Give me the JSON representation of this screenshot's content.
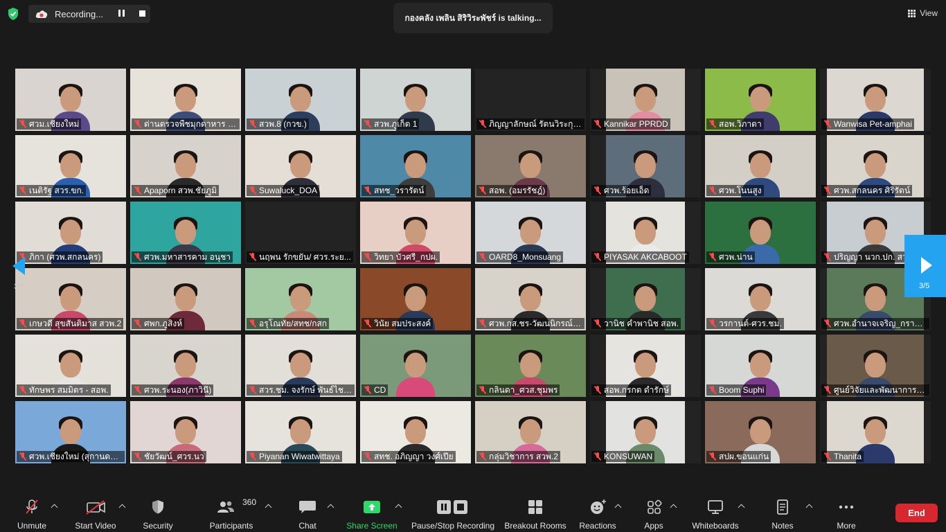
{
  "recording": {
    "label": "Recording..."
  },
  "talking": {
    "text": "กองคลัง เพลิน สิริวิระพัชร์ is  talking..."
  },
  "view": {
    "label": "View"
  },
  "pager": {
    "left": "3/5",
    "right": "3/5"
  },
  "colors": {
    "accent_blue": "#23a3f0",
    "end_red": "#d7282f",
    "share_green": "#2fd86a",
    "mic_off_red": "#ff4a4a"
  },
  "tiles": [
    {
      "name": "ศวม.เชียงใหม่",
      "bg": "#d9d4cf",
      "shirt": "#5b4a8a"
    },
    {
      "name": "ด่านตรวจพืชมุกดาหาร (ป...",
      "bg": "#e7e3da",
      "shirt": "#3d4d7a"
    },
    {
      "name": "สวพ.8 (กวข.)",
      "bg": "#c9d1d4",
      "shirt": "#2d3d5c"
    },
    {
      "name": "สวพ.ภูเก็ต 1",
      "bg": "#cfd5d2",
      "shirt": "#2f3a4a"
    },
    {
      "name": "ภิญญาลักษณ์ รัตนวิระกุล...",
      "bg": "#242424",
      "shirt": ""
    },
    {
      "name": "Kannikar PPRDD",
      "bg": "#c8c2b8",
      "shirt": "#e48da2"
    },
    {
      "name": "สอพ.วิภาดา",
      "bg": "#8dbb4a",
      "shirt": "#3f3c6e"
    },
    {
      "name": "Wanwisa Pet-amphai",
      "bg": "#dcd7d0",
      "shirt": "#2a3a66"
    },
    {
      "name": "เนติรัฐ สวร.ขก.",
      "bg": "#e6e2dc",
      "shirt": "#2b5fb0"
    },
    {
      "name": "Apaporn สวพ.ชัยภูมิ",
      "bg": "#d8d2cc",
      "shirt": "#2a2a2a"
    },
    {
      "name": "Suwaluck_DOA",
      "bg": "#e4ded6",
      "shirt": "#2f2f3b"
    },
    {
      "name": "สทช_วรารัตน์",
      "bg": "#4e8aa8",
      "shirt": "#3d3d3d"
    },
    {
      "name": "สอพ. (อมรรัชฎ์)",
      "bg": "#8a7a6e",
      "shirt": "#6a3a4a"
    },
    {
      "name": "ศวพ.ร้อยเอ็ด",
      "bg": "#5d6e7a",
      "shirt": "#2d2f3e"
    },
    {
      "name": "ศวพ.โนนสูง",
      "bg": "#d3cfc6",
      "shirt": "#2f4a7e"
    },
    {
      "name": "ศวพ.สกลนคร ศิริรัตน์",
      "bg": "#d9d5cc",
      "shirt": "#2f4a7e"
    },
    {
      "name": "ภิกา (ศวพ.สกลนคร)",
      "bg": "#e1ddd6",
      "shirt": "#243e7a"
    },
    {
      "name": "ศวพ.มหาสารคาม อนุชา",
      "bg": "#2fa5a0",
      "shirt": "#3a3a4a"
    },
    {
      "name": "นฤพน รักขยัน/ ศวร.ระย...",
      "bg": "#242424",
      "shirt": ""
    },
    {
      "name": "วิทยา บัวศรี_กปผ.",
      "bg": "#e8cfc6",
      "shirt": "#d24a6a"
    },
    {
      "name": "OARD8_Monsuang",
      "bg": "#d5d8da",
      "shirt": "#2a3a54"
    },
    {
      "name": "PIYASAK AKCABOOT",
      "bg": "#e5e3de",
      "shirt": "#eaeaea"
    },
    {
      "name": "ศวพ.น่าน",
      "bg": "#2d7040",
      "shirt": "#3a6aa8"
    },
    {
      "name": "ปริญญา นวก.ปก. สว...",
      "bg": "#c8cdd2",
      "shirt": "#3a3a3a"
    },
    {
      "name": "เกษวดี สุขสันติมาส สวพ.2",
      "bg": "#d6cdc4",
      "shirt": "#c84a6a"
    },
    {
      "name": "ศพก.ภูสิงห์",
      "bg": "#d1c8bf",
      "shirt": "#6e2a3a"
    },
    {
      "name": "อรุโณทัย/สทช/กสก",
      "bg": "#a3c9a3",
      "shirt": "#c98a7a"
    },
    {
      "name": "วินัย สมประสงค์",
      "bg": "#8a4a2a",
      "shirt": "#2a3a5a"
    },
    {
      "name": "ศวพ.กส.ชร-วัฒนนิกรณ์ เ...",
      "bg": "#d7d2ca",
      "shirt": "#2a2a2a"
    },
    {
      "name": "วานิช คำพานิช สอพ.",
      "bg": "#3e6e4e",
      "shirt": "#2a2a2a"
    },
    {
      "name": "วรกานต์-ศวร.ชม.",
      "bg": "#dcdad6",
      "shirt": "#3a3a3a"
    },
    {
      "name": "ศวพ.อำนาจเจริญ_กรานต์...",
      "bg": "#5a7a5a",
      "shirt": "#3a4a6a"
    },
    {
      "name": "ทักษพร สมมิตร - สอพ.",
      "bg": "#e4e0da",
      "shirt": "#e8e4e4"
    },
    {
      "name": "ศวพ.ระนอง(ภาวินี)",
      "bg": "#d8d4ce",
      "shirt": "#8a3a6a"
    },
    {
      "name": "สวร.ชม. จงรักษ์ พันธ์ไชย...",
      "bg": "#e2dfd9",
      "shirt": "#2a3a5a"
    },
    {
      "name": "CD",
      "bg": "#7a9a7a",
      "shirt": "#d84a7a"
    },
    {
      "name": "กลินดา_ศวส.ชุมพร",
      "bg": "#6a8a5a",
      "shirt": "#c84a6a"
    },
    {
      "name": "สอพ.กรกต ดำรักษ์",
      "bg": "#e6e4e0",
      "shirt": "#2a2a2a"
    },
    {
      "name": "Boom Suphi",
      "bg": "#d6d8d6",
      "shirt": "#7a3a8a"
    },
    {
      "name": "ศูนย์วิจัยและพัฒนาการเก...",
      "bg": "#6a5a4a",
      "shirt": "#3a4a6a"
    },
    {
      "name": "ศวพ.เชียงใหม่ (สุกานดา ใ...",
      "bg": "#7aa8d8",
      "shirt": "#1a1a1a"
    },
    {
      "name": "ชัยวัฒน์_ศวร.นว",
      "bg": "#e2d6d4",
      "shirt": "#c86a7a"
    },
    {
      "name": "Piyanan Wiwatwittaya",
      "bg": "#e6e2dc",
      "shirt": "#2a4a5a"
    },
    {
      "name": "สทช. อภิญญา วงศ์เปีย",
      "bg": "#ece8e2",
      "shirt": "#2a2a2a"
    },
    {
      "name": "กลุ่มวิชาการ สวพ.2",
      "bg": "#d5cfc4",
      "shirt": "#d86a9a"
    },
    {
      "name": "KONSUWAN",
      "bg": "#e2e2e0",
      "shirt": "#6a8a6a"
    },
    {
      "name": "สปผ.ขอนแก่น",
      "bg": "#8a6a5a",
      "shirt": "#d8d8d8"
    },
    {
      "name": "Thanita",
      "bg": "#dcd8d0",
      "shirt": "#2a3a6a"
    }
  ],
  "toolbar": {
    "unmute": "Unmute",
    "start_video": "Start Video",
    "security": "Security",
    "participants": "Participants",
    "participants_count": "360",
    "chat": "Chat",
    "share_screen": "Share Screen",
    "pause_stop": "Pause/Stop Recording",
    "breakout": "Breakout Rooms",
    "reactions": "Reactions",
    "apps": "Apps",
    "whiteboards": "Whiteboards",
    "notes": "Notes",
    "more": "More",
    "end": "End"
  }
}
